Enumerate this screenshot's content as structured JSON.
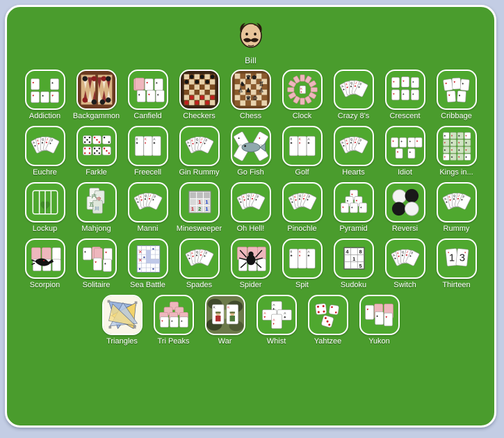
{
  "app": {
    "background_color": "#c3cde4",
    "panel_color": "#4a9c2d",
    "tile_color": "#4fa82f",
    "label_color": "#ffffff"
  },
  "profile": {
    "name": "Bill",
    "avatar_icon": "user-face-avatar-icon"
  },
  "rows": [
    {
      "tiles": [
        {
          "label": "Addiction",
          "icon": "addiction-game-icon",
          "art": "cards-grid"
        },
        {
          "label": "Backgammon",
          "icon": "backgammon-game-icon",
          "art": "backgammon-board"
        },
        {
          "label": "Canfield",
          "icon": "canfield-game-icon",
          "art": "canfield-cards"
        },
        {
          "label": "Checkers",
          "icon": "checkers-game-icon",
          "art": "checkers-board"
        },
        {
          "label": "Chess",
          "icon": "chess-game-icon",
          "art": "chess-board"
        },
        {
          "label": "Clock",
          "icon": "clock-game-icon",
          "art": "clock-cards"
        },
        {
          "label": "Crazy 8's",
          "icon": "crazy-eights-game-icon",
          "art": "fan-cards"
        },
        {
          "label": "Crescent",
          "icon": "crescent-game-icon",
          "art": "crescent-cards"
        },
        {
          "label": "Cribbage",
          "icon": "cribbage-game-icon",
          "art": "cribbage-cards"
        }
      ]
    },
    {
      "tiles": [
        {
          "label": "Euchre",
          "icon": "euchre-game-icon",
          "art": "fan-cards"
        },
        {
          "label": "Farkle",
          "icon": "farkle-game-icon",
          "art": "dice-grid"
        },
        {
          "label": "Freecell",
          "icon": "freecell-game-icon",
          "art": "columns-cards"
        },
        {
          "label": "Gin Rummy",
          "icon": "gin-rummy-game-icon",
          "art": "fan-cards"
        },
        {
          "label": "Go Fish",
          "icon": "go-fish-game-icon",
          "art": "gofish-fish"
        },
        {
          "label": "Golf",
          "icon": "golf-game-icon",
          "art": "columns-cards"
        },
        {
          "label": "Hearts",
          "icon": "hearts-game-icon",
          "art": "fan-cards"
        },
        {
          "label": "Idiot",
          "icon": "idiot-game-icon",
          "art": "idiot-cards"
        },
        {
          "label": "Kings in...",
          "icon": "kings-in-corner-game-icon",
          "art": "kings-grid"
        }
      ]
    },
    {
      "tiles": [
        {
          "label": "Lockup",
          "icon": "lockup-game-icon",
          "art": "lockup-bars"
        },
        {
          "label": "Mahjong",
          "icon": "mahjong-game-icon",
          "art": "mahjong-tiles"
        },
        {
          "label": "Manni",
          "icon": "manni-game-icon",
          "art": "fan-cards"
        },
        {
          "label": "Minesweeper",
          "icon": "minesweeper-game-icon",
          "art": "minesweeper-grid"
        },
        {
          "label": "Oh Hell!",
          "icon": "oh-hell-game-icon",
          "art": "fan-cards"
        },
        {
          "label": "Pinochle",
          "icon": "pinochle-game-icon",
          "art": "fan-cards"
        },
        {
          "label": "Pyramid",
          "icon": "pyramid-game-icon",
          "art": "pyramid-cards"
        },
        {
          "label": "Reversi",
          "icon": "reversi-game-icon",
          "art": "reversi-discs"
        },
        {
          "label": "Rummy",
          "icon": "rummy-game-icon",
          "art": "fan-cards"
        }
      ]
    },
    {
      "tiles": [
        {
          "label": "Scorpion",
          "icon": "scorpion-game-icon",
          "art": "scorpion-cards"
        },
        {
          "label": "Solitaire",
          "icon": "solitaire-game-icon",
          "art": "solitaire-cards"
        },
        {
          "label": "Sea Battle",
          "icon": "sea-battle-game-icon",
          "art": "seabattle-grid"
        },
        {
          "label": "Spades",
          "icon": "spades-game-icon",
          "art": "fan-cards"
        },
        {
          "label": "Spider",
          "icon": "spider-game-icon",
          "art": "spider-cards"
        },
        {
          "label": "Spit",
          "icon": "spit-game-icon",
          "art": "columns-cards"
        },
        {
          "label": "Sudoku",
          "icon": "sudoku-game-icon",
          "art": "sudoku-grid"
        },
        {
          "label": "Switch",
          "icon": "switch-game-icon",
          "art": "fan-cards"
        },
        {
          "label": "Thirteen",
          "icon": "thirteen-game-icon",
          "art": "thirteen-cards"
        }
      ]
    },
    {
      "tiles": [
        {
          "label": "Triangles",
          "icon": "triangles-game-icon",
          "art": "triangles-art"
        },
        {
          "label": "Tri Peaks",
          "icon": "tri-peaks-game-icon",
          "art": "tripeaks-cards"
        },
        {
          "label": "War",
          "icon": "war-game-icon",
          "art": "war-camo"
        },
        {
          "label": "Whist",
          "icon": "whist-game-icon",
          "art": "whist-cross"
        },
        {
          "label": "Yahtzee",
          "icon": "yahtzee-game-icon",
          "art": "yahtzee-dice"
        },
        {
          "label": "Yukon",
          "icon": "yukon-game-icon",
          "art": "yukon-cards"
        }
      ]
    }
  ],
  "tile_text": {
    "minesweeper_cells": [
      "1",
      "1",
      "1",
      "2",
      "1"
    ],
    "sudoku_cells": [
      "4",
      "8",
      "1",
      "5"
    ],
    "thirteen_cards": [
      "1",
      "3"
    ]
  }
}
